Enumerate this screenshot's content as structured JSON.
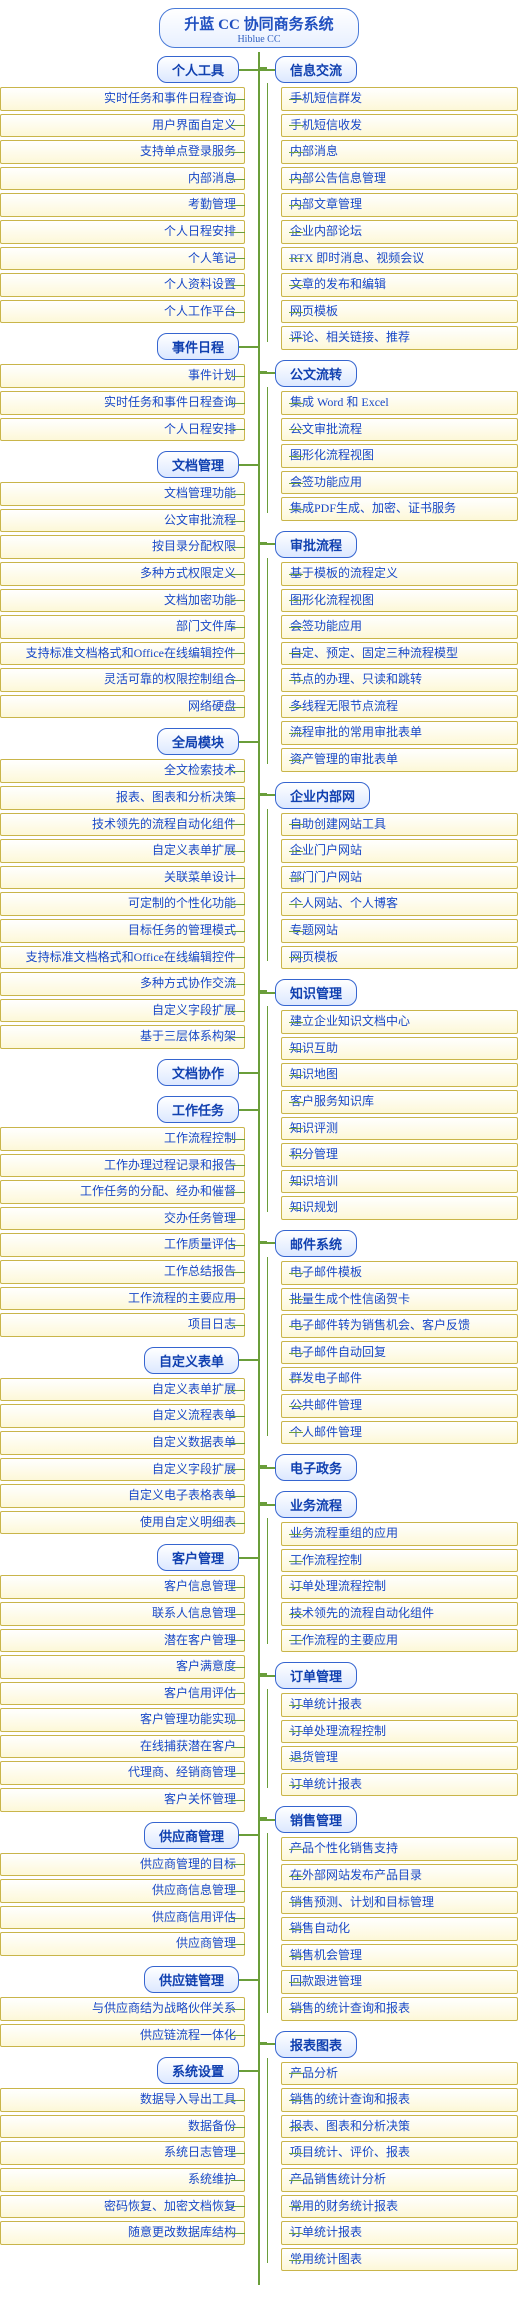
{
  "title": {
    "main": "升蓝 CC 协同商务系统",
    "sub": "Hiblue CC"
  },
  "left": [
    {
      "head": "个人工具",
      "items": [
        "实时任务和事件日程查询",
        "用户界面自定义",
        "支持单点登录服务",
        "内部消息",
        "考勤管理",
        "个人日程安排",
        "个人笔记",
        "个人资料设置",
        "个人工作平台"
      ]
    },
    {
      "head": "事件日程",
      "items": [
        "事件计划",
        "实时任务和事件日程查询",
        "个人日程安排"
      ]
    },
    {
      "head": "文档管理",
      "items": [
        "文档管理功能",
        "公文审批流程",
        "按目录分配权限",
        "多种方式权限定义",
        "文档加密功能",
        "部门文件库",
        "支持标准文档格式和Office在线编辑控件",
        "灵活可靠的权限控制组合",
        "网络硬盘"
      ]
    },
    {
      "head": "全局模块",
      "items": [
        "全文检索技术",
        "报表、图表和分析决策",
        "技术领先的流程自动化组件",
        "自定义表单扩展",
        "关联菜单设计",
        "可定制的个性化功能",
        "目标任务的管理模式",
        "支持标准文档格式和Office在线编辑控件",
        "多种方式协作交流",
        "自定义字段扩展",
        "基于三层体系构架"
      ]
    },
    {
      "head": "文档协作",
      "items": []
    },
    {
      "head": "工作任务",
      "items": [
        "工作流程控制",
        "工作办理过程记录和报告",
        "工作任务的分配、经办和催督",
        "交办任务管理",
        "工作质量评估",
        "工作总结报告",
        "工作流程的主要应用",
        "项目日志"
      ]
    },
    {
      "head": "自定义表单",
      "items": [
        "自定义表单扩展",
        "自定义流程表单",
        "自定义数据表单",
        "自定义字段扩展",
        "自定义电子表格表单",
        "使用自定义明细表"
      ]
    },
    {
      "head": "客户管理",
      "items": [
        "客户信息管理",
        "联系人信息管理",
        "潜在客户管理",
        "客户满意度",
        "客户信用评估",
        "客户管理功能实现",
        "在线捕获潜在客户",
        "代理商、经销商管理",
        "客户关怀管理"
      ]
    },
    {
      "head": "供应商管理",
      "items": [
        "供应商管理的目标",
        "供应商信息管理",
        "供应商信用评估",
        "供应商管理"
      ]
    },
    {
      "head": "供应链管理",
      "items": [
        "与供应商结为战略伙伴关系",
        "供应链流程一体化"
      ]
    },
    {
      "head": "系统设置",
      "items": [
        "数据导入导出工具",
        "数据备份",
        "系统日志管理",
        "系统维护",
        "密码恢复、加密文档恢复",
        "随意更改数据库结构"
      ]
    }
  ],
  "right": [
    {
      "head": "信息交流",
      "items": [
        "手机短信群发",
        "手机短信收发",
        "内部消息",
        "内部公告信息管理",
        "内部文章管理",
        "企业内部论坛",
        "RTX 即时消息、视频会议",
        "文章的发布和编辑",
        "网页模板",
        "评论、相关链接、推荐"
      ]
    },
    {
      "head": "公文流转",
      "items": [
        "集成 Word 和 Excel",
        "公文审批流程",
        "图形化流程视图",
        "会签功能应用",
        "集成PDF生成、加密、证书服务"
      ]
    },
    {
      "head": "审批流程",
      "items": [
        "基于模板的流程定义",
        "图形化流程视图",
        "会签功能应用",
        "自定、预定、固定三种流程模型",
        "节点的办理、只读和跳转",
        "多线程无限节点流程",
        "流程审批的常用审批表单",
        "资产管理的审批表单"
      ]
    },
    {
      "head": "企业内部网",
      "items": [
        "自助创建网站工具",
        "企业门户网站",
        "部门门户网站",
        "个人网站、个人博客",
        "专题网站",
        "网页模板"
      ]
    },
    {
      "head": "知识管理",
      "items": [
        "建立企业知识文档中心",
        "知识互助",
        "知识地图",
        "客户服务知识库",
        "知识评测",
        "积分管理",
        "知识培训",
        "知识规划"
      ]
    },
    {
      "head": "邮件系统",
      "items": [
        "电子邮件模板",
        "批量生成个性信函贺卡",
        "电子邮件转为销售机会、客户反馈",
        "电子邮件自动回复",
        "群发电子邮件",
        "公共邮件管理",
        "个人邮件管理"
      ]
    },
    {
      "head": "电子政务",
      "items": []
    },
    {
      "head": "业务流程",
      "items": [
        "业务流程重组的应用",
        "工作流程控制",
        "订单处理流程控制",
        "技术领先的流程自动化组件",
        "工作流程的主要应用"
      ]
    },
    {
      "head": "订单管理",
      "items": [
        "订单统计报表",
        "订单处理流程控制",
        "退货管理",
        "订单统计报表"
      ]
    },
    {
      "head": "销售管理",
      "items": [
        "产品个性化销售支持",
        "在外部网站发布产品目录",
        "销售预测、计划和目标管理",
        "销售自动化",
        "销售机会管理",
        "回款跟进管理",
        "销售的统计查询和报表"
      ]
    },
    {
      "head": "报表图表",
      "items": [
        "产品分析",
        "销售的统计查询和报表",
        "报表、图表和分析决策",
        "项目统计、评价、报表",
        "产品销售统计分析",
        "常用的财务统计报表",
        "订单统计报表",
        "常用统计图表"
      ]
    }
  ]
}
